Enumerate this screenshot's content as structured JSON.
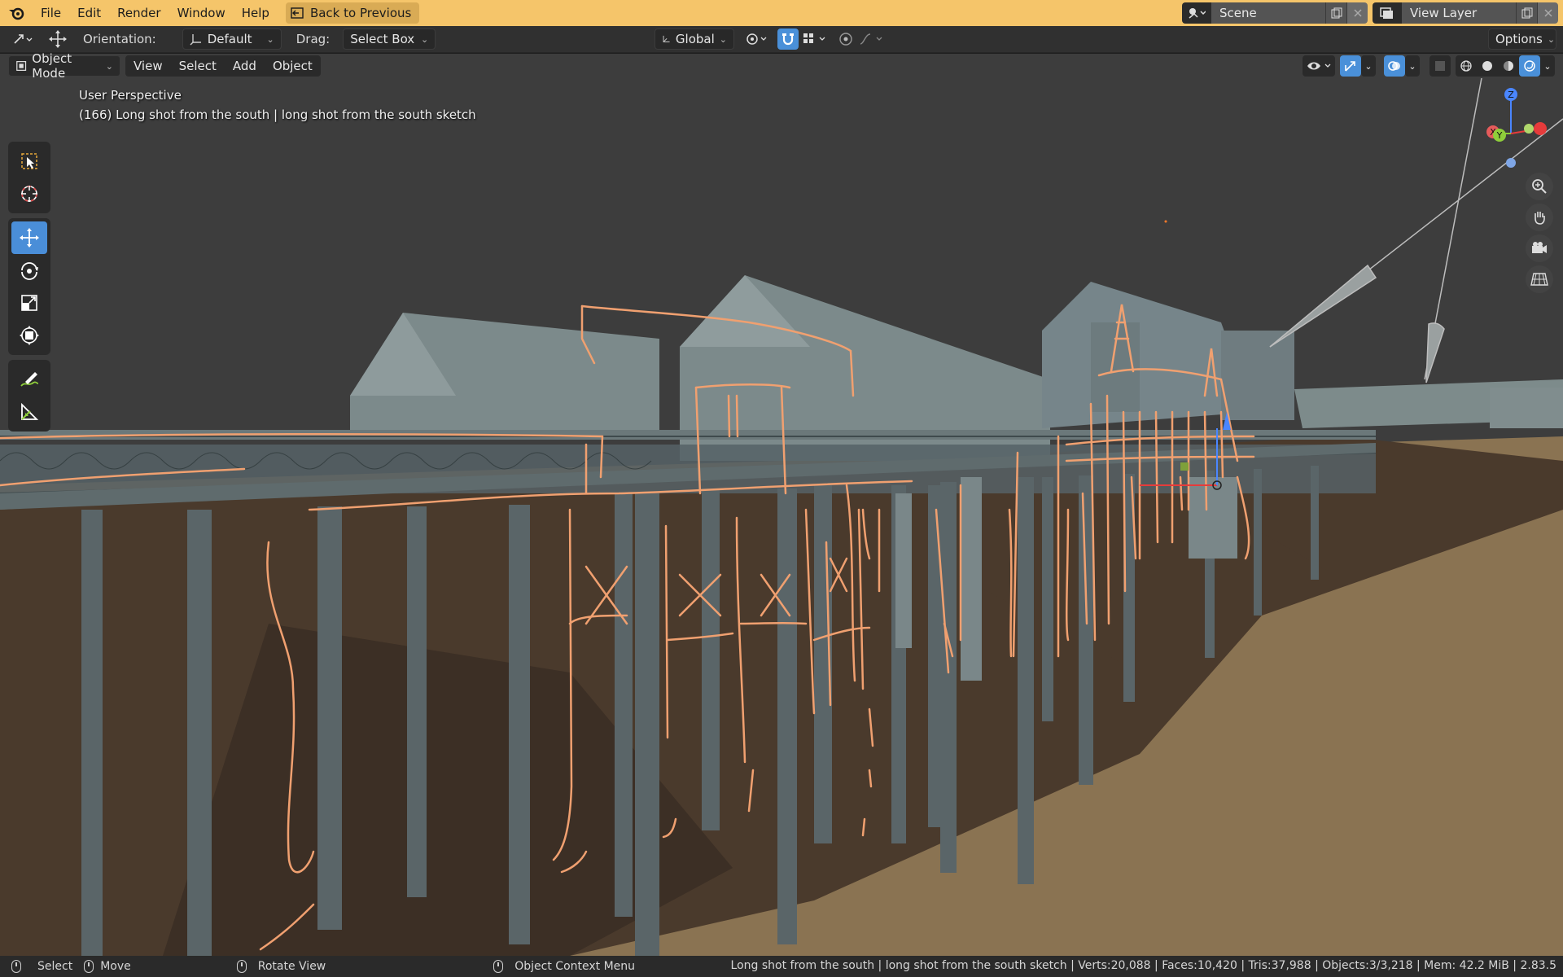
{
  "menubar": {
    "items": [
      "File",
      "Edit",
      "Render",
      "Window",
      "Help"
    ],
    "back_label": "Back to Previous",
    "scene": "Scene",
    "view_layer": "View Layer"
  },
  "toolheader": {
    "orientation_label": "Orientation:",
    "orientation_value": "Default",
    "drag_label": "Drag:",
    "drag_value": "Select Box",
    "transform_value": "Global",
    "options_label": "Options"
  },
  "vpheader": {
    "mode": "Object Mode",
    "menus": [
      "View",
      "Select",
      "Add",
      "Object"
    ]
  },
  "viewport": {
    "perspective": "User Perspective",
    "object_info": "(166) Long shot from the south | long shot from the south sketch"
  },
  "gizmo": {
    "z": "Z",
    "x": "X",
    "y": "Y"
  },
  "statusbar": {
    "select": "Select",
    "move": "Move",
    "rotate": "Rotate View",
    "context": "Object Context Menu",
    "stats": "Long shot from the south | long shot from the south sketch | Verts:20,088 | Faces:10,420 | Tris:37,988 | Objects:3/3,218 | Mem: 42.2 MiB | 2.83.5"
  },
  "colors": {
    "accent": "#4a90d9",
    "menubar": "#f5c56a",
    "sketch": "#f0a070",
    "ground": "#8a7352",
    "building": "#7c8a8b"
  }
}
